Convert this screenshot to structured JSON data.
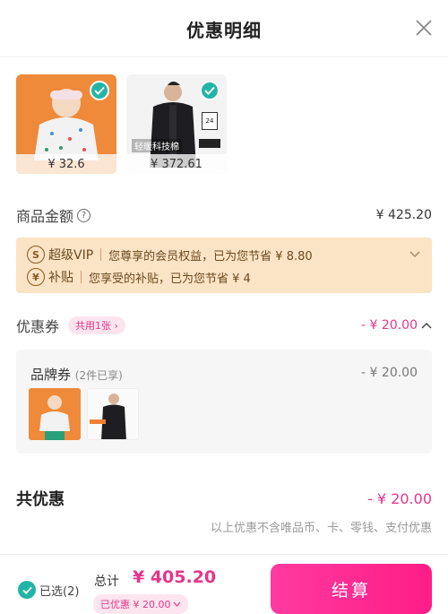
{
  "header": {
    "title": "优惠明细",
    "close_icon": "close-icon"
  },
  "products": [
    {
      "price": "¥ 32.6",
      "checked": true
    },
    {
      "price": "¥ 372.61",
      "overlay": "轻暖科技棉",
      "checked": true
    }
  ],
  "goods": {
    "label": "商品金额",
    "amount": "¥ 425.20"
  },
  "vip": {
    "badge": "S",
    "name": "超级VIP",
    "text": "您尊享的会员权益，已为您节省 ¥ 8.80",
    "subsidy_badge": "¥",
    "subsidy_name": "补贴",
    "subsidy_text": "您享受的补贴，已为您节省 ¥ 4"
  },
  "coupon": {
    "label": "优惠券",
    "pill": "共用1张 ›",
    "amount": "- ¥ 20.00"
  },
  "brand": {
    "title": "品牌券",
    "sub": "(2件已享)",
    "amount": "- ¥ 20.00"
  },
  "total": {
    "label": "共优惠",
    "amount": "- ¥ 20.00",
    "note": "以上优惠不含唯品币、卡、零钱、支付优惠"
  },
  "footer": {
    "selected": "已选(2)",
    "sum_label": "总计",
    "sum_amount": "¥ 405.20",
    "discount": "已优惠 ¥ 20.00",
    "pay_label": "结算"
  },
  "colors": {
    "accent": "#e4368a",
    "teal": "#21b5a8",
    "vip_bg": "#fbe3c5"
  }
}
